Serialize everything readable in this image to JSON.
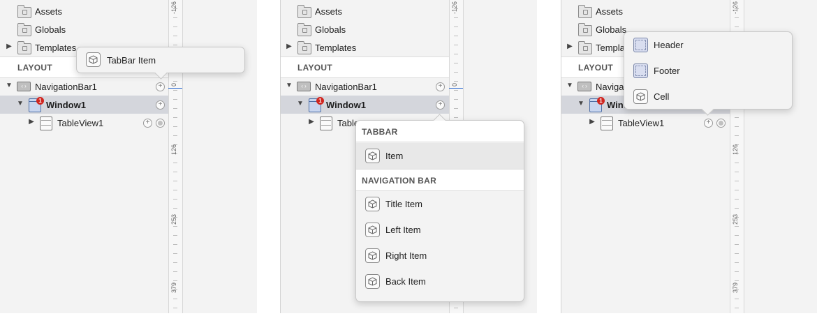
{
  "tree": {
    "assets": "Assets",
    "globals": "Globals",
    "templates": "Templates",
    "layout_header": "LAYOUT",
    "navigation_bar": "NavigationBar1",
    "window": "Window1",
    "window_badge": "1",
    "tableview": "TableView1",
    "templates_truncated": "Templa",
    "tableview_truncated": "Table",
    "navigation_truncated": "Navigat",
    "window_truncated": "Wind"
  },
  "ruler": {
    "ticks": [
      "-126",
      "0",
      "126",
      "253",
      "379"
    ]
  },
  "popup1": {
    "items": [
      {
        "label": "TabBar Item",
        "icon": "cube-icon"
      }
    ]
  },
  "popup2": {
    "sections": [
      {
        "header": "TABBAR",
        "items": [
          {
            "label": "Item",
            "icon": "cube-icon"
          }
        ]
      },
      {
        "header": "NAVIGATION BAR",
        "items": [
          {
            "label": "Title Item",
            "icon": "cube-icon"
          },
          {
            "label": "Left Item",
            "icon": "cube-icon"
          },
          {
            "label": "Right Item",
            "icon": "cube-icon"
          },
          {
            "label": "Back Item",
            "icon": "cube-icon"
          }
        ]
      }
    ]
  },
  "popup3": {
    "items": [
      {
        "label": "Header",
        "icon": "header-placeholder-icon"
      },
      {
        "label": "Footer",
        "icon": "footer-placeholder-icon"
      },
      {
        "label": "Cell",
        "icon": "cube-icon"
      }
    ]
  },
  "colors": {
    "selection": "#d4d6dc",
    "badge": "#d0251f",
    "accent": "#2f6cd0"
  }
}
